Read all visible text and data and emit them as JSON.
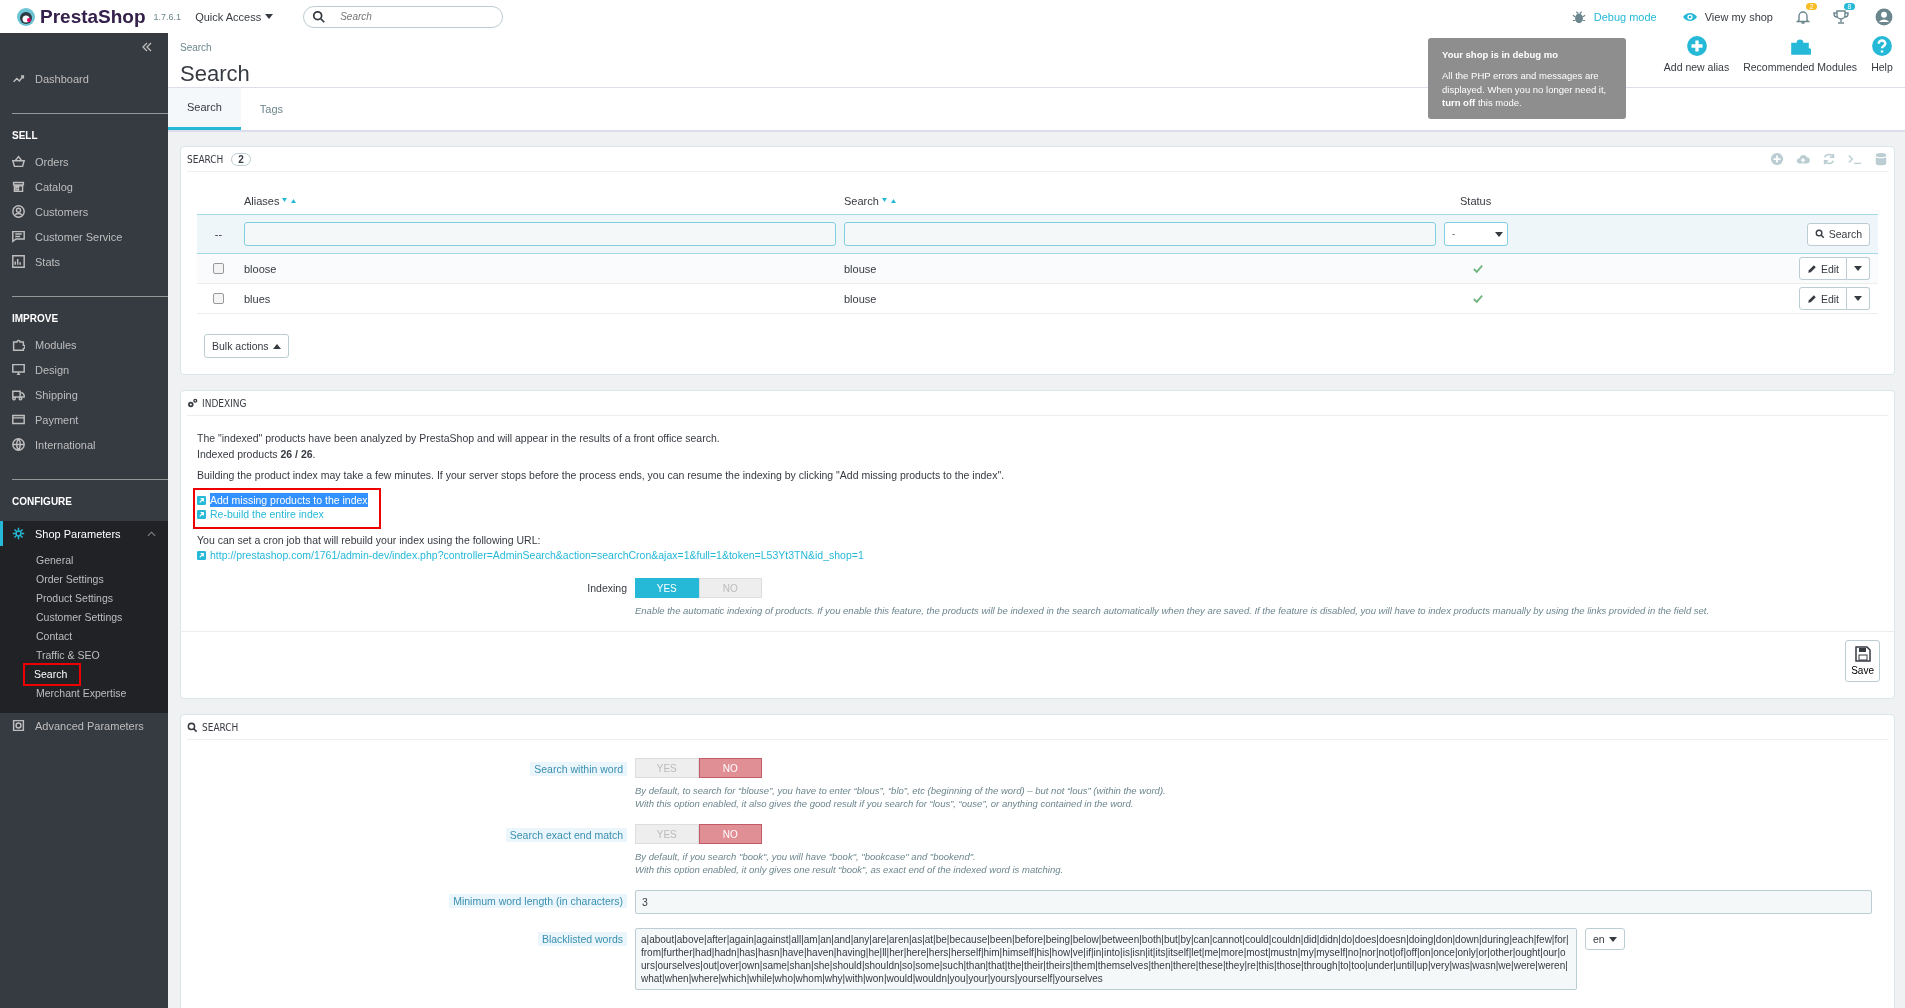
{
  "header": {
    "brand": "PrestaShop",
    "version": "1.7.6.1",
    "quick_access": "Quick Access",
    "search_placeholder": "Search",
    "debug_mode": "Debug mode",
    "view_shop": "View my shop",
    "badges": [
      {
        "count": "2",
        "color": "#fbbb22"
      },
      {
        "count": "8",
        "color": "#25b9d7"
      }
    ]
  },
  "debug_tooltip": {
    "title": "Your shop is in debug mo",
    "text": "All the PHP errors and messages are displayed. When you no longer need it, **turn off** this mode."
  },
  "sidebar": {
    "top_items": [
      {
        "label": "Dashboard",
        "selected": false
      }
    ],
    "sections": [
      {
        "heading": "SELL",
        "items": [
          {
            "label": "Orders",
            "selected": false
          },
          {
            "label": "Catalog",
            "selected": false
          },
          {
            "label": "Customers",
            "selected": false
          },
          {
            "label": "Customer Service",
            "selected": false
          },
          {
            "label": "Stats",
            "selected": false
          }
        ]
      },
      {
        "heading": "IMPROVE",
        "items": [
          {
            "label": "Modules",
            "selected": false
          },
          {
            "label": "Design",
            "selected": false
          },
          {
            "label": "Shipping",
            "selected": false
          },
          {
            "label": "Payment",
            "selected": false
          },
          {
            "label": "International",
            "selected": false
          }
        ]
      },
      {
        "heading": "CONFIGURE",
        "items": [
          {
            "label": "Shop Parameters",
            "selected": true,
            "expanded": true,
            "children": [
              {
                "label": "General",
                "selected": false,
                "highlighted": false
              },
              {
                "label": "Order Settings",
                "selected": false,
                "highlighted": false
              },
              {
                "label": "Product Settings",
                "selected": false,
                "highlighted": false
              },
              {
                "label": "Customer Settings",
                "selected": false,
                "highlighted": false
              },
              {
                "label": "Contact",
                "selected": false,
                "highlighted": false
              },
              {
                "label": "Traffic & SEO",
                "selected": false,
                "highlighted": false
              },
              {
                "label": "Search",
                "selected": true,
                "highlighted": true
              },
              {
                "label": "Merchant Expertise",
                "selected": false,
                "highlighted": false
              }
            ]
          },
          {
            "label": "Advanced Parameters",
            "selected": false
          }
        ]
      }
    ]
  },
  "page": {
    "breadcrumb": "Search",
    "title": "Search",
    "toolbar": [
      "Add new alias",
      "Recommended Modules",
      "Help"
    ],
    "tabs": [
      {
        "label": "Search",
        "selected": true
      },
      {
        "label": "Tags",
        "selected": false
      }
    ]
  },
  "aliases": {
    "title": "SEARCH",
    "count": "2",
    "columns": [
      {
        "label": "Aliases",
        "sortable": true
      },
      {
        "label": "Search",
        "sortable": true
      },
      {
        "label": "Status",
        "sortable": false
      }
    ],
    "filter": {
      "dash": "--",
      "status_value": "-",
      "button": "Search"
    },
    "rows": [
      {
        "alias": "bloose",
        "search": "blouse",
        "active": true,
        "checked": false,
        "action": "Edit"
      },
      {
        "alias": "blues",
        "search": "blouse",
        "active": true,
        "checked": false,
        "action": "Edit"
      }
    ],
    "bulk_actions": "Bulk actions"
  },
  "indexing": {
    "title": "INDEXING",
    "intro": "The \"indexed\" products have been analyzed by PrestaShop and will appear in the results of a front office search.",
    "count_line": "Indexed products **26 / 26**.",
    "note": "Building the product index may take a few minutes. If your server stops before the process ends, you can resume the indexing by clicking \"Add missing products to the index\".",
    "links": [
      {
        "label": "Add missing products to the index",
        "text_selected": true
      },
      {
        "label": "Re-build the entire index",
        "text_selected": false
      }
    ],
    "links_highlighted": true,
    "cron_text": "You can set a cron job that will rebuild your index using the following URL:",
    "cron_url": "http://prestashop.com/1761/admin-dev/index.php?controller=AdminSearch&action=searchCron&ajax=1&full=1&token=L53Yt3TN&id_shop=1",
    "switch": {
      "label": "Indexing",
      "options": [
        "YES",
        "NO"
      ],
      "on": true
    },
    "help": "Enable the automatic indexing of products. If you enable this feature, the products will be indexed in the search automatically when they are saved. If the feature is disabled, you will have to index products manually by using the links provided in the field set.",
    "save": "Save"
  },
  "search_settings": {
    "title": "SEARCH",
    "fields": [
      {
        "kind": "switch",
        "label": "Search within word",
        "options": [
          "YES",
          "NO"
        ],
        "on": false,
        "help": [
          "By default, to search for “blouse”, you have to enter “blous”, “blo”, etc (beginning of the word) – but not “lous” (within the word).",
          "With this option enabled, it also gives the good result if you search for “lous”, “ouse”, or anything contained in the word."
        ]
      },
      {
        "kind": "switch",
        "label": "Search exact end match",
        "options": [
          "YES",
          "NO"
        ],
        "on": false,
        "help": [
          "By default, if you search \"book\", you will have \"book\", \"bookcase\" and \"bookend\".",
          "With this option enabled, it only gives one result “book”, as exact end of the indexed word is matching."
        ]
      },
      {
        "kind": "text",
        "label": "Minimum word length (in characters)",
        "value": "3"
      },
      {
        "kind": "textarea",
        "label": "Blacklisted words",
        "value": "a|about|above|after|again|against|all|am|an|and|any|are|aren|as|at|be|because|been|before|being|below|between|both|but|by|can|cannot|could|couldn|did|didn|do|does|doesn|doing|don|down|during|each|few|for|from|further|had|hadn|has|hasn|have|haven|having|he|ll|her|here|hers|herself|him|himself|his|how|ve|if|in|into|is|isn|it|its|itself|let|me|more|most|mustn|my|myself|no|nor|not|of|off|on|once|only|or|other|ought|our|ours|ourselves|out|over|own|same|shan|she|should|shouldn|so|some|such|than|that|the|their|theirs|them|themselves|then|there|these|they|re|this|those|through|to|too|under|until|up|very|was|wasn|we|were|weren|what|when|where|which|while|who|whom|why|with|won|would|wouldn|you|your|yours|yourself|yourselves",
        "lang": "en"
      }
    ]
  }
}
